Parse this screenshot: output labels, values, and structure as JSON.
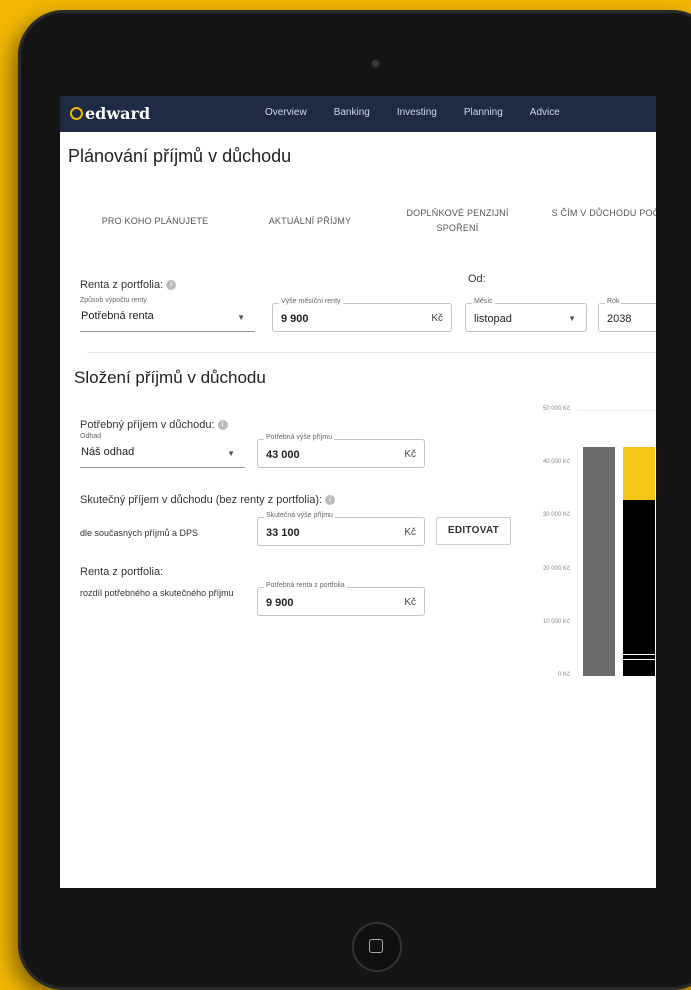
{
  "nav": {
    "brand": "edward",
    "links": [
      "Overview",
      "Banking",
      "Investing",
      "Planning",
      "Advice"
    ]
  },
  "page_title": "Plánování příjmů v důchodu",
  "steps": [
    "PRO KOHO PLÁNUJETE",
    "AKTUÁLNÍ PŘÍJMY",
    "DOPLŇKOVÉ PENZIJNÍ SPOŘENÍ",
    "S ČÍM V DŮCHODU POČÍTAT"
  ],
  "renta": {
    "label": "Renta z portfolia:",
    "od_label": "Od:",
    "method": {
      "label": "Způsob výpočtu renty",
      "value": "Potřebná renta"
    },
    "amount": {
      "label": "Výše měsíční renty",
      "value": "9 900",
      "unit": "Kč"
    },
    "month": {
      "label": "Měsíc",
      "value": "listopad"
    },
    "year": {
      "label": "Rok",
      "value": "2038"
    }
  },
  "composition": {
    "title": "Složení příjmů v důchodu",
    "needed": {
      "label": "Potřebný příjem v důchodu:",
      "estimate": {
        "label": "Odhad",
        "value": "Náš odhad"
      },
      "amount": {
        "label": "Potřebná výše příjmu",
        "value": "43 000",
        "unit": "Kč"
      }
    },
    "actual": {
      "label": "Skutečný příjem v důchodu (bez renty z portfolia):",
      "note": "dle současných příjmů a DPS",
      "amount": {
        "label": "Skutečná výše příjmu",
        "value": "33 100",
        "unit": "Kč"
      },
      "edit_button": "EDITOVAT"
    },
    "portfolio": {
      "label": "Renta z portfolia:",
      "note": "rozdíl potřebného a skutečného příjmu",
      "amount": {
        "label": "Potřebná renta z portfolia",
        "value": "9 900",
        "unit": "Kč"
      }
    }
  },
  "chart_data": {
    "type": "bar",
    "y_ticks": [
      "50 000 Kč",
      "40 000 Kč",
      "30 000 Kč",
      "20 000 Kč",
      "10 000 Kč",
      "0 Kč"
    ],
    "ylim": [
      0,
      50000
    ],
    "bars": [
      {
        "color": "#6b6b6b",
        "segments": [
          43000
        ]
      },
      {
        "colors": [
          "#000000",
          "#ffffff",
          "#000000",
          "#ffffff",
          "#000000",
          "#f5c518"
        ],
        "segments": [
          3000,
          200,
          800,
          200,
          28900,
          9900
        ]
      }
    ],
    "grid": false
  }
}
